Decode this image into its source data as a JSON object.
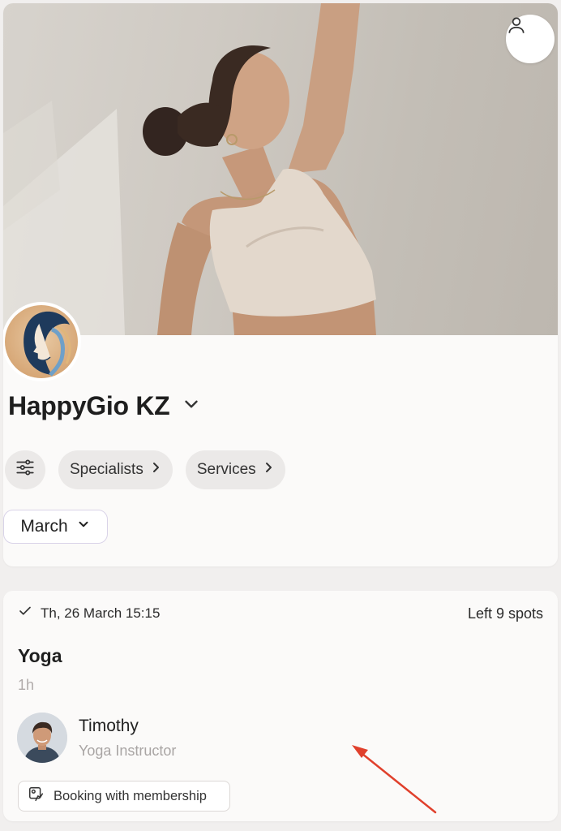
{
  "header": {
    "profile_icon": "user-icon",
    "hero_image": "woman-stretching-yoga-photo",
    "logo_image": "woman-profile-logo"
  },
  "studio": {
    "name": "HappyGio KZ",
    "dropdown_icon": "chevron-down-icon"
  },
  "filters": {
    "settings_icon": "sliders-icon",
    "specialists_label": "Specialists",
    "services_label": "Services",
    "month_label": "March"
  },
  "session": {
    "date_time": "Th, 26 March 15:15",
    "spots": "Left 9 spots",
    "class_name": "Yoga",
    "duration": "1h",
    "instructor_name": "Timothy",
    "instructor_role": "Yoga Instructor",
    "booking_label": "Booking with membership"
  },
  "colors": {
    "page_bg": "#f1efee",
    "card_bg": "#fbfaf9",
    "chip_bg": "#ebe9e8",
    "annotation_arrow": "#e0402c"
  }
}
